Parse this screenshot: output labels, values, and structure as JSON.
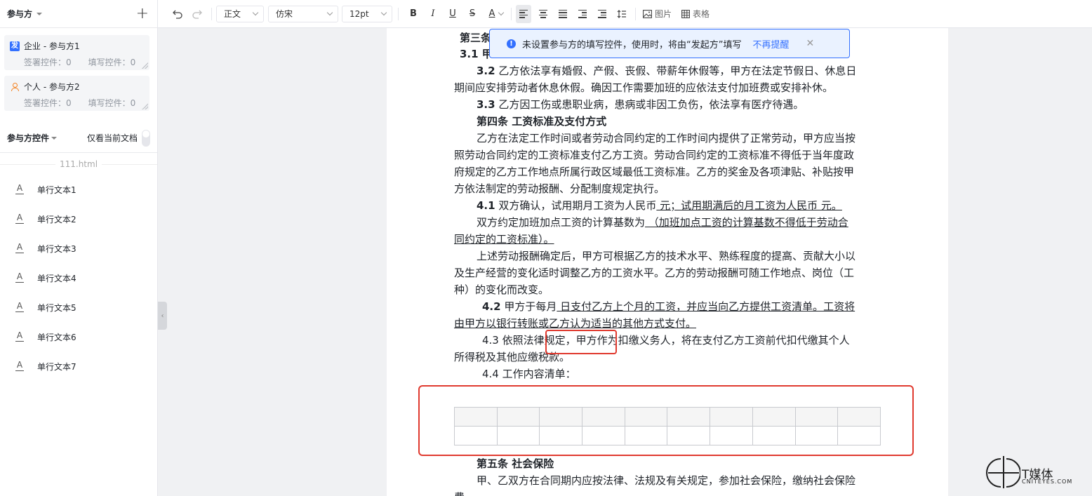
{
  "sidebar": {
    "title": "参与方",
    "parties": [
      {
        "label": "企业 - 参与方1",
        "icon_text": "发",
        "sign_label": "签署控件：",
        "sign_count": "0",
        "fill_label": "填写控件：",
        "fill_count": "0"
      },
      {
        "label": "个人 - 参与方2",
        "sign_label": "签署控件：",
        "sign_count": "0",
        "fill_label": "填写控件：",
        "fill_count": "0"
      }
    ],
    "controls_title": "参与方控件",
    "only_current_doc": "仅看当前文档",
    "file_name": "111.html",
    "controls": [
      "单行文本1",
      "单行文本2",
      "单行文本3",
      "单行文本4",
      "单行文本5",
      "单行文本6",
      "单行文本7"
    ]
  },
  "toolbar": {
    "style_value": "正文",
    "font_value": "仿宋",
    "size_value": "12pt",
    "image_label": "图片",
    "table_label": "表格"
  },
  "notice": {
    "text": "未设置参与方的填写控件，使用时，将由“发起方”填写",
    "link": "不再提醒"
  },
  "document": {
    "l1": "第三条",
    "l2": "3.1 甲",
    "l3a": "3.2",
    "l3b": " 乙方依法享有婚假、产假、丧假、带薪年休假等，甲方在法定节假日、休息日",
    "l4": "期间应安排劳动者休息休假。确因工作需要加班的应依法支付加班费或安排补休。",
    "l5a": "3.3",
    "l5b": " 乙方因工伤或患职业病，患病或非因工负伤，依法享有医疗待遇。",
    "l6": "第四条  工资标准及支付方式",
    "l7": "乙方在法定工作时间或者劳动合同约定的工作时间内提供了正常劳动，甲方应当按",
    "l8": "照劳动合同约定的工资标准支付乙方工资。劳动合同约定的工资标准不得低于当年度政",
    "l9": "府规定的乙方工作地点所属行政区域最低工资标准。乙方的奖金及各项津贴、补贴按甲",
    "l10": "方依法制定的劳动报酬、分配制度规定执行。",
    "l11a": "4.1",
    "l11b": " 双方确认，试用期月工资为人民币",
    "l11c": " 元；试用期满后的月工资为人民币 元。",
    "l12a": "双方约定加班加点工资的计算基数为",
    "l12b": " （加班加点工资的计算基数不得低于劳动合",
    "l13": "同约定的工资标准）。",
    "l14": "上述劳动报酬确定后，甲方可根据乙方的技术水平、熟练程度的提高、贡献大小以",
    "l15": "及生产经营的变化适时调整乙方的工资水平。乙方的劳动报酬可随工作地点、岗位（工",
    "l16": "种）的变化而改变。",
    "l17a": "4.2",
    "l17b": " 甲方于每月",
    "l17c": " 日支付乙方上个月的工资，并应当向乙方提供工资清单。工资将",
    "l18": "由甲方以银行转账或乙方认为适当的其他方式支付。",
    "l19": "4.3 依照法律规定，甲方作为扣缴义务人，将在支付乙方工资前代扣代缴其个人",
    "l20": "所得税及其他应缴税款。",
    "l21": "4.4 工作内容清单：",
    "l22": "第五条 社会保险",
    "l23": "甲、乙双方在合同期内应按法律、法规及有关规定，参加社会保险，缴纳社会保险",
    "l24": "费"
  },
  "watermark": {
    "name": "T媒体",
    "site": "CNITEYES.COM"
  }
}
